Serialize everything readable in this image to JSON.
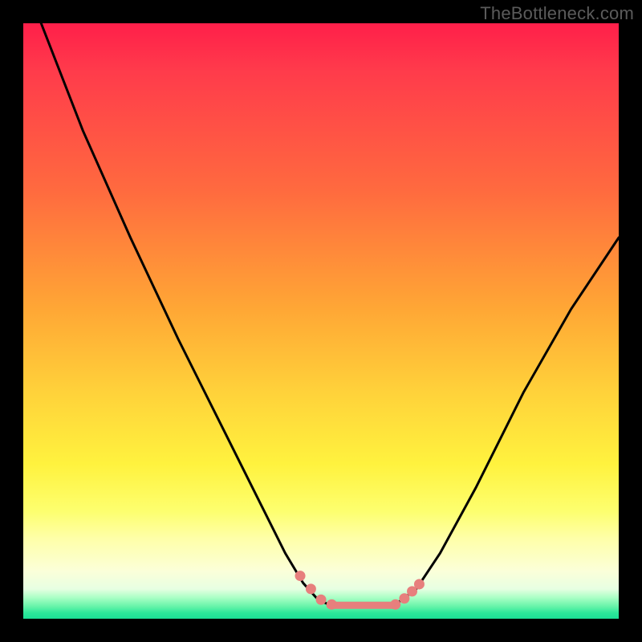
{
  "watermark": "TheBottleneck.com",
  "colors": {
    "frame": "#000000",
    "gradient_top": "#ff1f4a",
    "gradient_mid1": "#ffa735",
    "gradient_mid2": "#fff23e",
    "gradient_band": "#fbffd9",
    "gradient_bottom": "#1bdf95",
    "curve": "#000000",
    "marker": "#e77f7d"
  },
  "chart_data": {
    "type": "line",
    "title": "",
    "xlabel": "",
    "ylabel": "",
    "xlim": [
      0,
      100
    ],
    "ylim": [
      0,
      100
    ],
    "series": [
      {
        "name": "left-curve",
        "x": [
          3,
          10,
          18,
          26,
          34,
          40,
          44,
          47,
          49.5,
          51.5
        ],
        "y": [
          100,
          82,
          64,
          47,
          31,
          19,
          11,
          6,
          3.2,
          2.3
        ]
      },
      {
        "name": "valley-flat",
        "x": [
          51.5,
          54,
          57,
          60,
          62.5
        ],
        "y": [
          2.3,
          2.1,
          2.0,
          2.1,
          2.4
        ]
      },
      {
        "name": "right-curve",
        "x": [
          62.5,
          66,
          70,
          76,
          84,
          92,
          100
        ],
        "y": [
          2.4,
          5,
          11,
          22,
          38,
          52,
          64
        ]
      }
    ],
    "markers": [
      {
        "x": 46.5,
        "y": 7.2
      },
      {
        "x": 48.3,
        "y": 5.0
      },
      {
        "x": 50.0,
        "y": 3.2
      },
      {
        "x": 51.8,
        "y": 2.4
      },
      {
        "x": 62.5,
        "y": 2.4
      },
      {
        "x": 64.0,
        "y": 3.4
      },
      {
        "x": 65.3,
        "y": 4.6
      },
      {
        "x": 66.5,
        "y": 5.8
      }
    ],
    "flat_segments": [
      {
        "x1": 51.5,
        "y1": 2.25,
        "x2": 62.5,
        "y2": 2.25
      }
    ]
  }
}
